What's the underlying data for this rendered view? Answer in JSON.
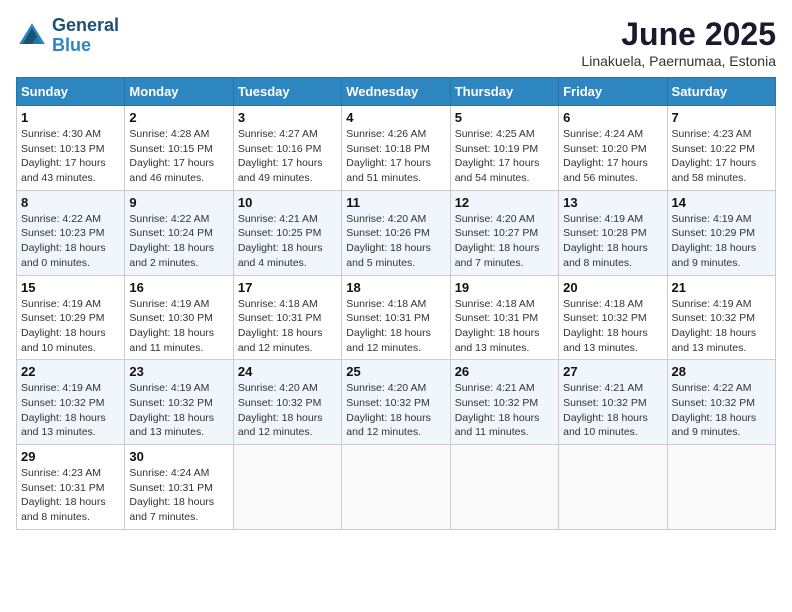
{
  "logo": {
    "line1": "General",
    "line2": "Blue"
  },
  "title": "June 2025",
  "location": "Linakuela, Paernumaa, Estonia",
  "days_of_week": [
    "Sunday",
    "Monday",
    "Tuesday",
    "Wednesday",
    "Thursday",
    "Friday",
    "Saturday"
  ],
  "weeks": [
    [
      {
        "day": "1",
        "info": "Sunrise: 4:30 AM\nSunset: 10:13 PM\nDaylight: 17 hours\nand 43 minutes."
      },
      {
        "day": "2",
        "info": "Sunrise: 4:28 AM\nSunset: 10:15 PM\nDaylight: 17 hours\nand 46 minutes."
      },
      {
        "day": "3",
        "info": "Sunrise: 4:27 AM\nSunset: 10:16 PM\nDaylight: 17 hours\nand 49 minutes."
      },
      {
        "day": "4",
        "info": "Sunrise: 4:26 AM\nSunset: 10:18 PM\nDaylight: 17 hours\nand 51 minutes."
      },
      {
        "day": "5",
        "info": "Sunrise: 4:25 AM\nSunset: 10:19 PM\nDaylight: 17 hours\nand 54 minutes."
      },
      {
        "day": "6",
        "info": "Sunrise: 4:24 AM\nSunset: 10:20 PM\nDaylight: 17 hours\nand 56 minutes."
      },
      {
        "day": "7",
        "info": "Sunrise: 4:23 AM\nSunset: 10:22 PM\nDaylight: 17 hours\nand 58 minutes."
      }
    ],
    [
      {
        "day": "8",
        "info": "Sunrise: 4:22 AM\nSunset: 10:23 PM\nDaylight: 18 hours\nand 0 minutes."
      },
      {
        "day": "9",
        "info": "Sunrise: 4:22 AM\nSunset: 10:24 PM\nDaylight: 18 hours\nand 2 minutes."
      },
      {
        "day": "10",
        "info": "Sunrise: 4:21 AM\nSunset: 10:25 PM\nDaylight: 18 hours\nand 4 minutes."
      },
      {
        "day": "11",
        "info": "Sunrise: 4:20 AM\nSunset: 10:26 PM\nDaylight: 18 hours\nand 5 minutes."
      },
      {
        "day": "12",
        "info": "Sunrise: 4:20 AM\nSunset: 10:27 PM\nDaylight: 18 hours\nand 7 minutes."
      },
      {
        "day": "13",
        "info": "Sunrise: 4:19 AM\nSunset: 10:28 PM\nDaylight: 18 hours\nand 8 minutes."
      },
      {
        "day": "14",
        "info": "Sunrise: 4:19 AM\nSunset: 10:29 PM\nDaylight: 18 hours\nand 9 minutes."
      }
    ],
    [
      {
        "day": "15",
        "info": "Sunrise: 4:19 AM\nSunset: 10:29 PM\nDaylight: 18 hours\nand 10 minutes."
      },
      {
        "day": "16",
        "info": "Sunrise: 4:19 AM\nSunset: 10:30 PM\nDaylight: 18 hours\nand 11 minutes."
      },
      {
        "day": "17",
        "info": "Sunrise: 4:18 AM\nSunset: 10:31 PM\nDaylight: 18 hours\nand 12 minutes."
      },
      {
        "day": "18",
        "info": "Sunrise: 4:18 AM\nSunset: 10:31 PM\nDaylight: 18 hours\nand 12 minutes."
      },
      {
        "day": "19",
        "info": "Sunrise: 4:18 AM\nSunset: 10:31 PM\nDaylight: 18 hours\nand 13 minutes."
      },
      {
        "day": "20",
        "info": "Sunrise: 4:18 AM\nSunset: 10:32 PM\nDaylight: 18 hours\nand 13 minutes."
      },
      {
        "day": "21",
        "info": "Sunrise: 4:19 AM\nSunset: 10:32 PM\nDaylight: 18 hours\nand 13 minutes."
      }
    ],
    [
      {
        "day": "22",
        "info": "Sunrise: 4:19 AM\nSunset: 10:32 PM\nDaylight: 18 hours\nand 13 minutes."
      },
      {
        "day": "23",
        "info": "Sunrise: 4:19 AM\nSunset: 10:32 PM\nDaylight: 18 hours\nand 13 minutes."
      },
      {
        "day": "24",
        "info": "Sunrise: 4:20 AM\nSunset: 10:32 PM\nDaylight: 18 hours\nand 12 minutes."
      },
      {
        "day": "25",
        "info": "Sunrise: 4:20 AM\nSunset: 10:32 PM\nDaylight: 18 hours\nand 12 minutes."
      },
      {
        "day": "26",
        "info": "Sunrise: 4:21 AM\nSunset: 10:32 PM\nDaylight: 18 hours\nand 11 minutes."
      },
      {
        "day": "27",
        "info": "Sunrise: 4:21 AM\nSunset: 10:32 PM\nDaylight: 18 hours\nand 10 minutes."
      },
      {
        "day": "28",
        "info": "Sunrise: 4:22 AM\nSunset: 10:32 PM\nDaylight: 18 hours\nand 9 minutes."
      }
    ],
    [
      {
        "day": "29",
        "info": "Sunrise: 4:23 AM\nSunset: 10:31 PM\nDaylight: 18 hours\nand 8 minutes."
      },
      {
        "day": "30",
        "info": "Sunrise: 4:24 AM\nSunset: 10:31 PM\nDaylight: 18 hours\nand 7 minutes."
      },
      null,
      null,
      null,
      null,
      null
    ]
  ]
}
